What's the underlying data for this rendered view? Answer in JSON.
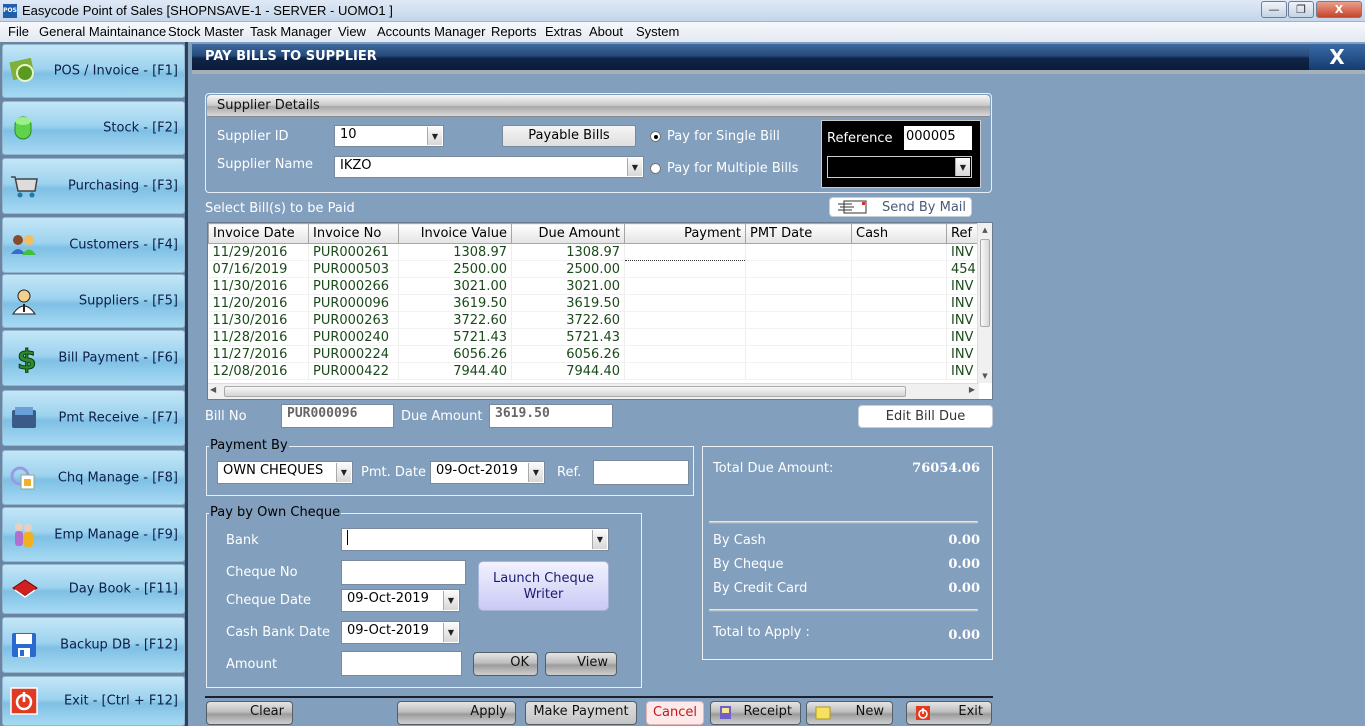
{
  "window": {
    "title": "Easycode Point of Sales [SHOPNSAVE-1 - SERVER - UOMO1 ]",
    "app_icon": "POS",
    "controls": {
      "minimize": "—",
      "restore": "❐",
      "close": "X"
    }
  },
  "menu": [
    "File",
    "General Maintainance",
    "Stock Master",
    "Task Manager",
    "View",
    "Accounts Manager",
    "Reports",
    "Extras",
    "About",
    "System"
  ],
  "sidebar": [
    {
      "label": "POS / Invoice - [F1]",
      "icon": "pos-invoice-icon"
    },
    {
      "label": "Stock - [F2]",
      "icon": "stock-cylinder-icon"
    },
    {
      "label": "Purchasing - [F3]",
      "icon": "shopping-cart-icon"
    },
    {
      "label": "Customers - [F4]",
      "icon": "customers-icon"
    },
    {
      "label": "Suppliers - [F5]",
      "icon": "supplier-person-icon"
    },
    {
      "label": "Bill Payment - [F6]",
      "icon": "dollar-sign-icon"
    },
    {
      "label": "Pmt Receive - [F7]",
      "icon": "wallet-cards-icon"
    },
    {
      "label": "Chq Manage - [F8]",
      "icon": "cheque-manage-icon"
    },
    {
      "label": "Emp Manage - [F9]",
      "icon": "employees-icon"
    },
    {
      "label": "Day Book - [F11]",
      "icon": "book-icon"
    },
    {
      "label": "Backup DB - [F12]",
      "icon": "floppy-disk-icon"
    },
    {
      "label": "Exit - [Ctrl + F12]",
      "icon": "power-icon"
    }
  ],
  "panel": {
    "title": "PAY BILLS TO SUPPLIER",
    "close": "X"
  },
  "supplier": {
    "section_title": "Supplier Details",
    "id_label": "Supplier ID",
    "id_value": "10",
    "name_label": "Supplier Name",
    "name_value": "IKZO",
    "payable_bills": "Payable Bills",
    "radio_single": "Pay for Single Bill",
    "radio_multiple": "Pay for Multiple Bills",
    "selected_mode": "single",
    "reference_label": "Reference",
    "reference_value": "000005",
    "reference_combo": ""
  },
  "bills": {
    "label": "Select Bill(s) to be Paid",
    "send_mail": "Send By Mail",
    "columns": [
      "Invoice Date",
      "Invoice No",
      "Invoice Value",
      "Due Amount",
      "Payment",
      "PMT Date",
      "Cash",
      "Ref"
    ],
    "rows": [
      [
        "11/29/2016",
        "PUR000261",
        "1308.97",
        "1308.97",
        "",
        "",
        "",
        "INV"
      ],
      [
        "07/16/2019",
        "PUR000503",
        "2500.00",
        "2500.00",
        "",
        "",
        "",
        "454"
      ],
      [
        "11/30/2016",
        "PUR000266",
        "3021.00",
        "3021.00",
        "",
        "",
        "",
        "INV"
      ],
      [
        "11/20/2016",
        "PUR000096",
        "3619.50",
        "3619.50",
        "",
        "",
        "",
        "INV"
      ],
      [
        "11/30/2016",
        "PUR000263",
        "3722.60",
        "3722.60",
        "",
        "",
        "",
        "INV"
      ],
      [
        "11/28/2016",
        "PUR000240",
        "5721.43",
        "5721.43",
        "",
        "",
        "",
        "INV"
      ],
      [
        "11/27/2016",
        "PUR000224",
        "6056.26",
        "6056.26",
        "",
        "",
        "",
        "INV"
      ],
      [
        "12/08/2016",
        "PUR000422",
        "7944.40",
        "7944.40",
        "",
        "",
        "",
        "INV"
      ]
    ]
  },
  "bill": {
    "no_label": "Bill No",
    "no_value": "PUR000096",
    "due_label": "Due Amount",
    "due_value": "3619.50",
    "edit_due": "Edit Bill Due"
  },
  "payment_by": {
    "title": "Payment By",
    "method": "OWN CHEQUES",
    "date_label": "Pmt. Date",
    "date_value": "09-Oct-2019",
    "ref_label": "Ref.",
    "ref_value": ""
  },
  "cheque": {
    "title": "Pay by Own Cheque",
    "bank_label": "Bank",
    "bank_value": "",
    "no_label": "Cheque No",
    "no_value": "",
    "date_label": "Cheque Date",
    "date_value": "09-Oct-2019",
    "cash_date_label": "Cash Bank Date",
    "cash_date_value": "09-Oct-2019",
    "amount_label": "Amount",
    "amount_value": "",
    "launch": "Launch Cheque Writer",
    "ok": "OK",
    "view": "View"
  },
  "summary": {
    "total_due_label": "Total Due Amount:",
    "total_due": "76054.06",
    "cash_label": "By Cash",
    "cash": "0.00",
    "cheque_label": "By Cheque",
    "cheque": "0.00",
    "card_label": "By Credit Card",
    "card": "0.00",
    "apply_label": "Total to Apply :",
    "apply": "0.00"
  },
  "actions": {
    "clear": "Clear",
    "apply": "Apply",
    "make_payment": "Make Payment",
    "cancel": "Cancel",
    "receipt": "Receipt",
    "new": "New",
    "exit": "Exit"
  }
}
